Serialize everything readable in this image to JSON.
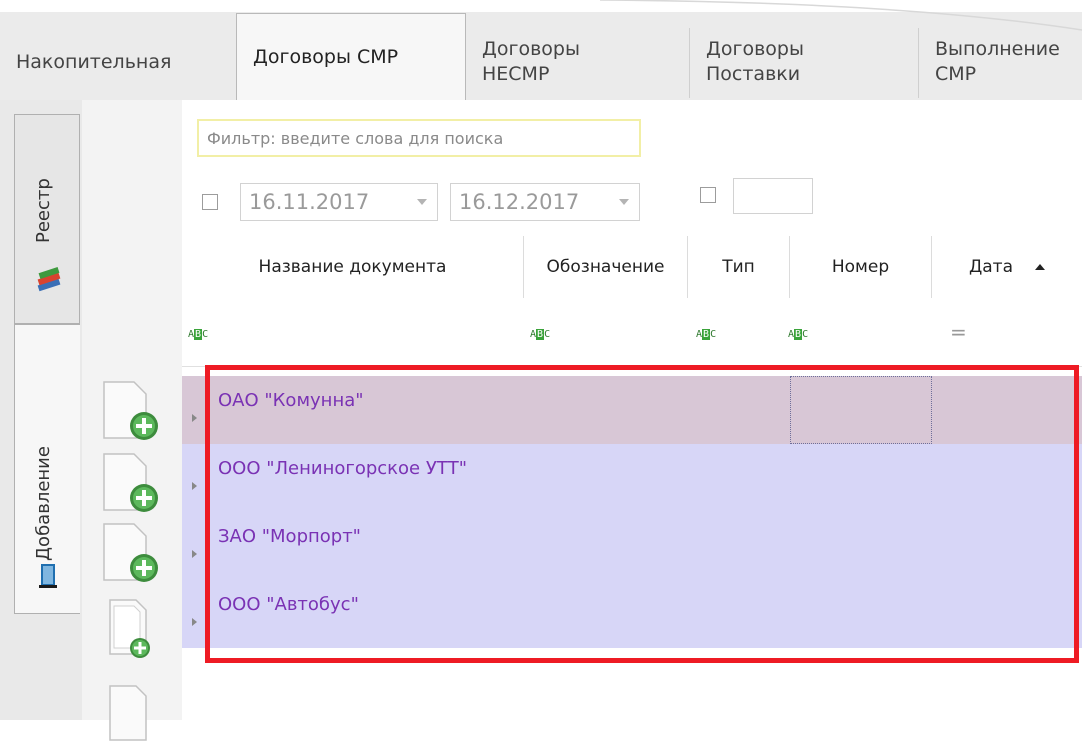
{
  "tabs": [
    {
      "label": "Накопительная",
      "active": false
    },
    {
      "label": "Договоры СМР",
      "active": true
    },
    {
      "label": "Договоры\nНЕСМР",
      "active": false
    },
    {
      "label": "Договоры\nПоставки",
      "active": false
    },
    {
      "label": "Выполнение\nСМР",
      "active": false
    }
  ],
  "side_tabs": [
    {
      "label": "Реестр",
      "icon": "books-icon",
      "active": false
    },
    {
      "label": "Добавление",
      "icon": "book-add-icon",
      "active": true
    }
  ],
  "filter": {
    "placeholder": "Фильтр: введите слова для поиска"
  },
  "date_from": {
    "value": "16.11.2017",
    "checked": false
  },
  "date_to": {
    "value": "16.12.2017"
  },
  "extra_filter": {
    "checked": false,
    "value": ""
  },
  "columns": [
    "Название документа",
    "Обозначение",
    "Тип",
    "Номер",
    "Дата"
  ],
  "sort": {
    "column": "Дата",
    "direction": "ascending"
  },
  "filter_row_icons": [
    "abc-filter-icon",
    "abc-filter-icon",
    "abc-filter-icon",
    "abc-filter-icon",
    "equals-filter-icon"
  ],
  "filter_row_text": {
    "abc": "ABC",
    "eq": "="
  },
  "rows": [
    {
      "name": "ОАО \"Комунна\"",
      "selected": true
    },
    {
      "name": "ООО \"Лениногорское УТТ\"",
      "selected": true
    },
    {
      "name": "ЗАО \"Морпорт\"",
      "selected": true
    },
    {
      "name": "ООО \"Автобус\"",
      "selected": true
    }
  ],
  "colors": {
    "accent_red": "#ee1b24",
    "row_text": "#7a32b4",
    "selection": "#d7d6f7",
    "focused_row": "#d8c7d6"
  }
}
